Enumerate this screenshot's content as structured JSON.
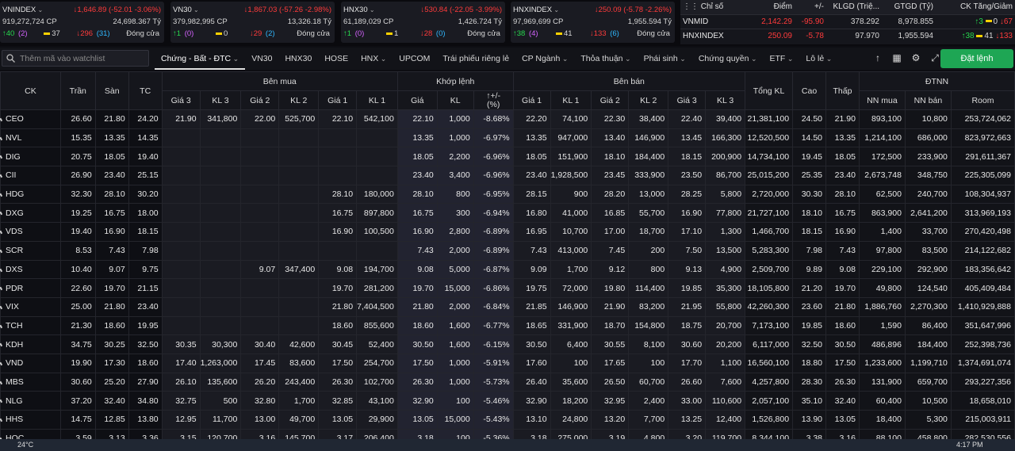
{
  "indices": [
    {
      "name": "VNINDEX",
      "change": "1,646.89 (-52.01 -3.06%)",
      "volume": "919,272,724 CP",
      "value": "24,698.367 Tỷ",
      "up": "40",
      "up_ceil": "(2)",
      "flat": "37",
      "down": "296",
      "down_floor": "(31)",
      "status": "Đóng cửa"
    },
    {
      "name": "VN30",
      "change": "1,867.03 (-57.26 -2.98%)",
      "volume": "379,982,995 CP",
      "value": "13,326.18 Tỷ",
      "up": "1",
      "up_ceil": "(0)",
      "flat": "0",
      "down": "29",
      "down_floor": "(2)",
      "status": "Đóng cửa"
    },
    {
      "name": "HNX30",
      "change": "530.84 (-22.05 -3.99%)",
      "volume": "61,189,029 CP",
      "value": "1,426.724 Tỷ",
      "up": "1",
      "up_ceil": "(0)",
      "flat": "1",
      "down": "28",
      "down_floor": "(0)",
      "status": "Đóng cửa"
    },
    {
      "name": "HNXINDEX",
      "change": "250.09 (-5.78 -2.26%)",
      "volume": "97,969,699 CP",
      "value": "1,955.594 Tỷ",
      "up": "38",
      "up_ceil": "(4)",
      "flat": "41",
      "down": "133",
      "down_floor": "(6)",
      "status": "Đóng cửa"
    }
  ],
  "mini": {
    "headers": [
      "Chỉ số",
      "Điểm",
      "+/-",
      "KLGD (Triệ...",
      "GTGD (Tỷ)",
      "CK Tăng/Giảm"
    ],
    "rows": [
      {
        "name": "VNMID",
        "point": "2,142.29",
        "change": "-95.90",
        "vol": "378.292",
        "val": "8,978.855",
        "up": "3",
        "flat": "0",
        "down": "67"
      },
      {
        "name": "HNXINDEX",
        "point": "250.09",
        "change": "-5.78",
        "vol": "97.970",
        "val": "1,955.594",
        "up": "38",
        "flat": "41",
        "down": "133"
      }
    ]
  },
  "toolbar": {
    "search_placeholder": "Thêm mã vào watchlist",
    "tabs": [
      "Chứng - Bất - ĐTC",
      "VN30",
      "HNX30",
      "HOSE",
      "HNX",
      "UPCOM",
      "Trái phiếu riêng lẻ",
      "CP Ngành",
      "Thỏa thuận",
      "Phái sinh",
      "Chứng quyền",
      "ETF",
      "Lô lẻ"
    ],
    "order_button": "Đặt lệnh"
  },
  "headers": {
    "ck": "CK",
    "tran": "Trần",
    "san": "Sàn",
    "tc": "TC",
    "ben_mua": "Bên mua",
    "khop_lenh": "Khớp lệnh",
    "ben_ban": "Bên bán",
    "tong_kl": "Tổng KL",
    "cao": "Cao",
    "thap": "Thấp",
    "dtnn": "ĐTNN",
    "gia3": "Giá 3",
    "kl3": "KL 3",
    "gia2": "Giá 2",
    "kl2": "KL 2",
    "gia1": "Giá 1",
    "kl1": "KL 1",
    "gia": "Giá",
    "kl": "KL",
    "pct": "+/-\n(%)",
    "nn_mua": "NN mua",
    "nn_ban": "NN bán",
    "room": "Room"
  },
  "rows": [
    [
      "CEO",
      "26.60",
      "21.80",
      "24.20",
      "21.90",
      "341,800",
      "22.00",
      "525,700",
      "22.10",
      "542,100",
      "22.10",
      "1,000",
      "-8.68%",
      "22.20",
      "74,100",
      "22.30",
      "38,400",
      "22.40",
      "39,400",
      "21,381,100",
      "24.50",
      "21.90",
      "893,100",
      "10,800",
      "253,724,062"
    ],
    [
      "NVL",
      "15.35",
      "13.35",
      "14.35",
      "",
      "",
      "",
      "",
      "",
      "",
      "13.35",
      "1,000",
      "-6.97%",
      "13.35",
      "947,000",
      "13.40",
      "146,900",
      "13.45",
      "166,300",
      "12,520,500",
      "14.50",
      "13.35",
      "1,214,100",
      "686,000",
      "823,972,663"
    ],
    [
      "DIG",
      "20.75",
      "18.05",
      "19.40",
      "",
      "",
      "",
      "",
      "",
      "",
      "18.05",
      "2,200",
      "-6.96%",
      "18.05",
      "151,900",
      "18.10",
      "184,400",
      "18.15",
      "200,900",
      "14,734,100",
      "19.45",
      "18.05",
      "172,500",
      "233,900",
      "291,611,367"
    ],
    [
      "CII",
      "26.90",
      "23.40",
      "25.15",
      "",
      "",
      "",
      "",
      "",
      "",
      "23.40",
      "3,400",
      "-6.96%",
      "23.40",
      "1,928,500",
      "23.45",
      "333,900",
      "23.50",
      "86,700",
      "25,015,200",
      "25.35",
      "23.40",
      "2,673,748",
      "348,750",
      "225,305,099"
    ],
    [
      "HDG",
      "32.30",
      "28.10",
      "30.20",
      "",
      "",
      "",
      "",
      "28.10",
      "180,000",
      "28.10",
      "800",
      "-6.95%",
      "28.15",
      "900",
      "28.20",
      "13,000",
      "28.25",
      "5,800",
      "2,720,000",
      "30.30",
      "28.10",
      "62,500",
      "240,700",
      "108,304,937"
    ],
    [
      "DXG",
      "19.25",
      "16.75",
      "18.00",
      "",
      "",
      "",
      "",
      "16.75",
      "897,800",
      "16.75",
      "300",
      "-6.94%",
      "16.80",
      "41,000",
      "16.85",
      "55,700",
      "16.90",
      "77,800",
      "21,727,100",
      "18.10",
      "16.75",
      "863,900",
      "2,641,200",
      "313,969,193"
    ],
    [
      "VDS",
      "19.40",
      "16.90",
      "18.15",
      "",
      "",
      "",
      "",
      "16.90",
      "100,500",
      "16.90",
      "2,800",
      "-6.89%",
      "16.95",
      "10,700",
      "17.00",
      "18,700",
      "17.10",
      "1,300",
      "1,466,700",
      "18.15",
      "16.90",
      "1,400",
      "33,700",
      "270,420,498"
    ],
    [
      "SCR",
      "8.53",
      "7.43",
      "7.98",
      "",
      "",
      "",
      "",
      "",
      "",
      "7.43",
      "2,000",
      "-6.89%",
      "7.43",
      "413,000",
      "7.45",
      "200",
      "7.50",
      "13,500",
      "5,283,300",
      "7.98",
      "7.43",
      "97,800",
      "83,500",
      "214,122,682"
    ],
    [
      "DXS",
      "10.40",
      "9.07",
      "9.75",
      "",
      "",
      "9.07",
      "347,400",
      "9.08",
      "194,700",
      "9.08",
      "5,000",
      "-6.87%",
      "9.09",
      "1,700",
      "9.12",
      "800",
      "9.13",
      "4,900",
      "2,509,700",
      "9.89",
      "9.08",
      "229,100",
      "292,900",
      "183,356,642"
    ],
    [
      "PDR",
      "22.60",
      "19.70",
      "21.15",
      "",
      "",
      "",
      "",
      "19.70",
      "281,200",
      "19.70",
      "15,000",
      "-6.86%",
      "19.75",
      "72,000",
      "19.80",
      "114,400",
      "19.85",
      "35,300",
      "18,105,800",
      "21.20",
      "19.70",
      "49,800",
      "124,540",
      "405,409,484"
    ],
    [
      "VIX",
      "25.00",
      "21.80",
      "23.40",
      "",
      "",
      "",
      "",
      "21.80",
      "7,404,500",
      "21.80",
      "2,000",
      "-6.84%",
      "21.85",
      "146,900",
      "21.90",
      "83,200",
      "21.95",
      "55,800",
      "42,260,300",
      "23.60",
      "21.80",
      "1,886,760",
      "2,270,300",
      "1,410,929,888"
    ],
    [
      "TCH",
      "21.30",
      "18.60",
      "19.95",
      "",
      "",
      "",
      "",
      "18.60",
      "855,600",
      "18.60",
      "1,600",
      "-6.77%",
      "18.65",
      "331,900",
      "18.70",
      "154,800",
      "18.75",
      "20,700",
      "7,173,100",
      "19.85",
      "18.60",
      "1,590",
      "86,400",
      "351,647,996"
    ],
    [
      "KDH",
      "34.75",
      "30.25",
      "32.50",
      "30.35",
      "30,300",
      "30.40",
      "42,600",
      "30.45",
      "52,400",
      "30.50",
      "1,600",
      "-6.15%",
      "30.50",
      "6,400",
      "30.55",
      "8,100",
      "30.60",
      "20,200",
      "6,117,000",
      "32.50",
      "30.50",
      "486,896",
      "184,400",
      "252,398,736"
    ],
    [
      "VND",
      "19.90",
      "17.30",
      "18.60",
      "17.40",
      "1,263,000",
      "17.45",
      "83,600",
      "17.50",
      "254,700",
      "17.50",
      "1,000",
      "-5.91%",
      "17.60",
      "100",
      "17.65",
      "100",
      "17.70",
      "1,100",
      "16,560,100",
      "18.80",
      "17.50",
      "1,233,600",
      "1,199,710",
      "1,374,691,074"
    ],
    [
      "MBS",
      "30.60",
      "25.20",
      "27.90",
      "26.10",
      "135,600",
      "26.20",
      "243,400",
      "26.30",
      "102,700",
      "26.30",
      "1,000",
      "-5.73%",
      "26.40",
      "35,600",
      "26.50",
      "60,700",
      "26.60",
      "7,600",
      "4,257,800",
      "28.30",
      "26.30",
      "131,900",
      "659,700",
      "293,227,356"
    ],
    [
      "NLG",
      "37.20",
      "32.40",
      "34.80",
      "32.75",
      "500",
      "32.80",
      "1,700",
      "32.85",
      "43,100",
      "32.90",
      "100",
      "-5.46%",
      "32.90",
      "18,200",
      "32.95",
      "2,400",
      "33.00",
      "110,600",
      "2,057,100",
      "35.10",
      "32.40",
      "60,400",
      "10,500",
      "18,658,010"
    ],
    [
      "HHS",
      "14.75",
      "12.85",
      "13.80",
      "12.95",
      "11,700",
      "13.00",
      "49,700",
      "13.05",
      "29,900",
      "13.05",
      "15,000",
      "-5.43%",
      "13.10",
      "24,800",
      "13.20",
      "7,700",
      "13.25",
      "12,400",
      "1,526,800",
      "13.90",
      "13.05",
      "18,400",
      "5,300",
      "215,003,911"
    ],
    [
      "HQC",
      "3.59",
      "3.13",
      "3.36",
      "3.15",
      "120,700",
      "3.16",
      "145,700",
      "3.17",
      "206,400",
      "3.18",
      "100",
      "-5.36%",
      "3.18",
      "275,000",
      "3.19",
      "4,800",
      "3.20",
      "119,700",
      "8,344,100",
      "3.38",
      "3.16",
      "88,100",
      "458,800",
      "282,530,556"
    ]
  ],
  "taskbar": {
    "weather": "24°C",
    "time": "4:17 PM"
  },
  "colors": {
    "up": "#27d94e",
    "down": "#ff3b3b",
    "ref": "#ffd200",
    "ceil": "#d563ff",
    "floor": "#2fb8ff",
    "order_button": "#1ea654"
  }
}
